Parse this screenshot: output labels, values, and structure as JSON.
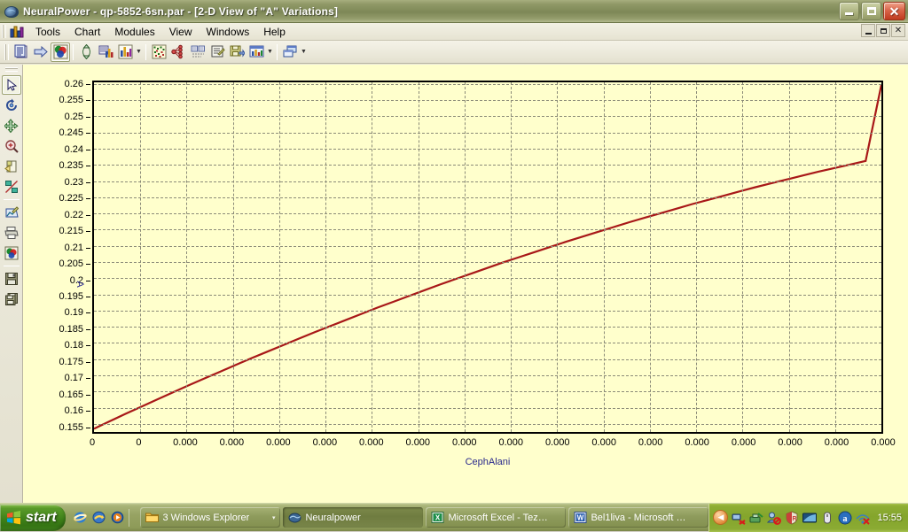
{
  "window": {
    "title": "NeuralPower - qp-5852-6sn.par - [2-D View of \"A\" Variations]",
    "icon": "brain-icon",
    "minimize_label": "",
    "maximize_label": "",
    "close_label": "✕"
  },
  "mdi_child": {
    "minimize_label": "_",
    "restore_label": "❐",
    "close_label": "✕"
  },
  "menu": {
    "items": [
      {
        "label": "Tools",
        "name": "menu-tools"
      },
      {
        "label": "Chart",
        "name": "menu-chart"
      },
      {
        "label": "Modules",
        "name": "menu-modules"
      },
      {
        "label": "View",
        "name": "menu-view"
      },
      {
        "label": "Windows",
        "name": "menu-windows"
      },
      {
        "label": "Help",
        "name": "menu-help"
      }
    ]
  },
  "toolbar": {
    "buttons": [
      {
        "name": "report-icon",
        "title": "Report"
      },
      {
        "name": "next-arrow-icon",
        "title": "Next"
      },
      {
        "name": "3d-view-icon",
        "title": "3-D View"
      },
      {
        "name": "sort-updown-icon",
        "title": "Sort"
      },
      {
        "name": "data-chart-icon",
        "title": "Data Chart"
      },
      {
        "name": "bar-chart-icon",
        "title": "Bar Chart"
      },
      {
        "name": "scatter-matrix-icon",
        "title": "Scatter Matrix"
      },
      {
        "name": "network-icon",
        "title": "Network"
      },
      {
        "name": "compare-icon",
        "title": "Compare"
      },
      {
        "name": "properties-icon",
        "title": "Properties"
      },
      {
        "name": "save-chart-icon",
        "title": "Save Chart"
      },
      {
        "name": "chart-type-icon",
        "title": "Chart Type"
      },
      {
        "name": "arrange-icon",
        "title": "Arrange Windows"
      }
    ]
  },
  "tool_palette": {
    "buttons": [
      {
        "name": "pointer-tool",
        "title": "Select"
      },
      {
        "name": "rotate-tool",
        "title": "Rotate"
      },
      {
        "name": "pan-tool",
        "title": "Pan"
      },
      {
        "name": "zoom-in-tool",
        "title": "Zoom"
      },
      {
        "name": "page-turn-tool",
        "title": "Page"
      },
      {
        "name": "color-split-tool",
        "title": "Color"
      },
      {
        "name": "plot-edit-tool",
        "title": "Edit Plot"
      },
      {
        "name": "print-tool",
        "title": "Print"
      },
      {
        "name": "palette-tool",
        "title": "Palette"
      },
      {
        "name": "save-tool",
        "title": "Save"
      },
      {
        "name": "copy-tool",
        "title": "Copy"
      }
    ]
  },
  "chart_data": {
    "type": "line",
    "title": "2-D View of \"A\" Variations",
    "xlabel": "CephAlani",
    "ylabel": "A",
    "grid": true,
    "legend": false,
    "line_color": "#a81818",
    "plot_bg": "#ffffcc",
    "axis_color": "#000000",
    "ylim": [
      0.1525,
      0.2605
    ],
    "yticks": [
      0.155,
      0.16,
      0.165,
      0.17,
      0.175,
      0.18,
      0.185,
      0.19,
      0.195,
      0.2,
      0.205,
      0.21,
      0.215,
      0.22,
      0.225,
      0.23,
      0.235,
      0.24,
      0.245,
      0.25,
      0.255,
      0.26
    ],
    "ytick_labels": [
      "0.155",
      "0.16",
      "0.165",
      "0.17",
      "0.175",
      "0.18",
      "0.185",
      "0.19",
      "0.195",
      "0.2",
      "0.205",
      "0.21",
      "0.215",
      "0.22",
      "0.225",
      "0.23",
      "0.235",
      "0.24",
      "0.245",
      "0.25",
      "0.255",
      "0.26"
    ],
    "xtick_labels": [
      "0",
      "0",
      "0.000",
      "0.000",
      "0.000",
      "0.000",
      "0.000",
      "0.000",
      "0.000",
      "0.000",
      "0.000",
      "0.000",
      "0.000",
      "0.000",
      "0.000",
      "0.000",
      "0.000",
      "0.000"
    ],
    "x_fraction": [
      0.0,
      0.056,
      0.111,
      0.167,
      0.222,
      0.278,
      0.333,
      0.389,
      0.444,
      0.5,
      0.556,
      0.611,
      0.667,
      0.722,
      0.778,
      0.833,
      0.889,
      0.944,
      1.0
    ],
    "values": [
      0.1535,
      0.1598,
      0.1659,
      0.1719,
      0.1777,
      0.1833,
      0.1888,
      0.1941,
      0.1992,
      0.2041,
      0.2088,
      0.2133,
      0.2176,
      0.2217,
      0.2256,
      0.2293,
      0.2328,
      0.2361,
      0.2392
    ],
    "values_dense_x": [
      0.0,
      0.02,
      0.04,
      0.06,
      0.08,
      0.1,
      0.12,
      0.14,
      0.16,
      0.18,
      0.2,
      0.22,
      0.24,
      0.26,
      0.28,
      0.3,
      0.32,
      0.34,
      0.36,
      0.38,
      0.4,
      0.42,
      0.44,
      0.46,
      0.48,
      0.5,
      0.52,
      0.54,
      0.56,
      0.58,
      0.6,
      0.62,
      0.64,
      0.66,
      0.68,
      0.7,
      0.72,
      0.74,
      0.76,
      0.78,
      0.8,
      0.82,
      0.84,
      0.86,
      0.88,
      0.9,
      0.92,
      0.94,
      0.96,
      0.98,
      1.0
    ],
    "values_dense_y": [
      0.1535,
      0.1558,
      0.1581,
      0.1603,
      0.1625,
      0.1647,
      0.1669,
      0.169,
      0.1711,
      0.1732,
      0.1753,
      0.1773,
      0.1793,
      0.1813,
      0.1833,
      0.1852,
      0.1871,
      0.189,
      0.1909,
      0.1927,
      0.1945,
      0.1963,
      0.1981,
      0.1998,
      0.2015,
      0.2032,
      0.2049,
      0.2065,
      0.2081,
      0.2097,
      0.2113,
      0.2128,
      0.2143,
      0.2158,
      0.2173,
      0.2187,
      0.2201,
      0.2215,
      0.2229,
      0.2242,
      0.2255,
      0.2268,
      0.2281,
      0.2293,
      0.2305,
      0.2317,
      0.2329,
      0.234,
      0.2351,
      0.2362,
      0.2598
    ]
  },
  "taskbar": {
    "start_label": "start",
    "quick_launch": [
      {
        "name": "internet-explorer-icon"
      },
      {
        "name": "show-desktop-icon"
      },
      {
        "name": "media-player-icon"
      }
    ],
    "tasks": [
      {
        "name": "taskbutton-windows-explorer",
        "label": "3 Windows Explorer",
        "icon": "folder-icon",
        "active": false,
        "caret": "▾"
      },
      {
        "name": "taskbutton-neuralpower",
        "label": "Neuralpower",
        "icon": "brain-icon",
        "active": true,
        "caret": ""
      },
      {
        "name": "taskbutton-excel",
        "label": "Microsoft Excel - Tez…",
        "icon": "excel-icon",
        "active": false,
        "caret": ""
      },
      {
        "name": "taskbutton-word",
        "label": "Bel1liva - Microsoft …",
        "icon": "word-icon",
        "active": false,
        "caret": ""
      }
    ],
    "tray_icons": [
      {
        "name": "network-disconnected-icon"
      },
      {
        "name": "safely-remove-hardware-icon"
      },
      {
        "name": "user-accounts-icon"
      },
      {
        "name": "security-alert-icon"
      },
      {
        "name": "display-adapter-icon"
      },
      {
        "name": "usb-device-icon"
      },
      {
        "name": "adobe-icon"
      },
      {
        "name": "wireless-disconnected-icon"
      }
    ],
    "tray_expand_label": "◀",
    "clock": "15:55"
  }
}
